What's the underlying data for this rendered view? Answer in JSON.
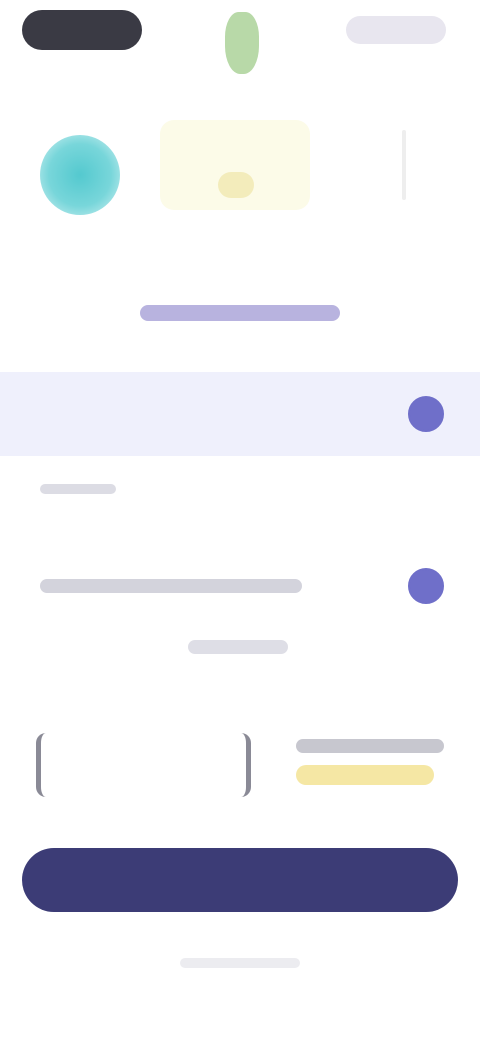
{
  "header": {
    "title": ""
  },
  "plans": [
    {
      "label": ""
    },
    {
      "label": ""
    }
  ],
  "input": {
    "value": ""
  },
  "price": {
    "amount": ""
  },
  "cta": {
    "label": ""
  },
  "colors": {
    "accent": "#6f6fc9",
    "primary_button": "#3c3c76",
    "selected_row": "#eff0fc",
    "teal": "#54c9cf",
    "highlight_yellow": "#f5e7a4"
  }
}
